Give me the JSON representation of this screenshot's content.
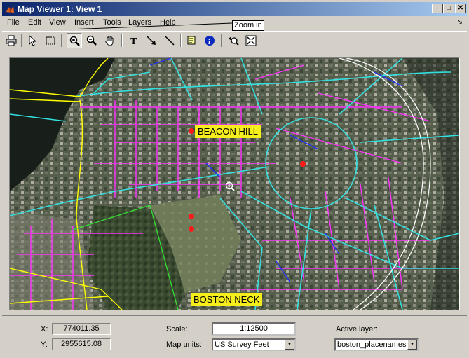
{
  "window": {
    "title": "Map Viewer 1: View 1"
  },
  "menu": [
    "File",
    "Edit",
    "View",
    "Insert",
    "Tools",
    "Layers",
    "Help"
  ],
  "toolbar": {
    "tooltip": "Zoom in",
    "buttons": [
      "print-icon",
      "select-arrow-icon",
      "select-area-icon",
      "zoom-in-icon",
      "zoom-out-icon",
      "pan-hand-icon",
      "insert-text-icon",
      "insert-arrow-icon",
      "insert-line-icon",
      "datatip-icon",
      "info-icon",
      "previous-extent-icon",
      "fit-to-window-icon"
    ]
  },
  "map": {
    "labels": {
      "beacon_hill": "BEACON HILL",
      "boston_neck": "BOSTON NECK"
    },
    "colors": {
      "label_bg": "#f6ee1c",
      "roads": "#ff33ff",
      "streets": "#33e0e0",
      "boundary": "#ffff00",
      "points": "#ff0000"
    }
  },
  "status": {
    "x_label": "X:",
    "x_value": "774011.35",
    "y_label": "Y:",
    "y_value": "2955615.08",
    "scale_label": "Scale:",
    "scale_value": "1:12500",
    "units_label": "Map units:",
    "units_value": "US Survey Feet",
    "layer_label": "Active layer:",
    "layer_value": "boston_placenames"
  }
}
